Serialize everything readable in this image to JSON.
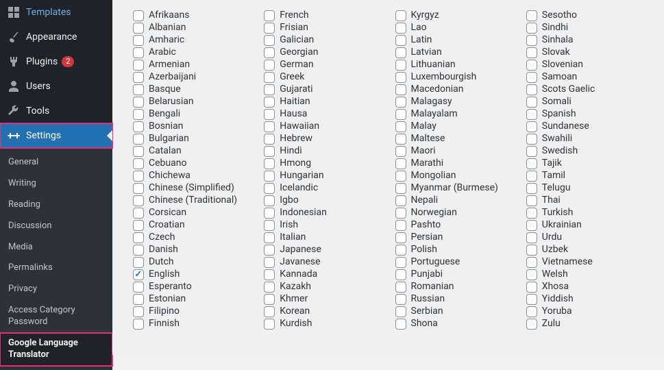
{
  "sidebar": {
    "menu": [
      {
        "id": "templates",
        "label": "Templates",
        "icon": "templates"
      },
      {
        "id": "appearance",
        "label": "Appearance",
        "icon": "brush"
      },
      {
        "id": "plugins",
        "label": "Plugins",
        "icon": "plug",
        "badge": "2"
      },
      {
        "id": "users",
        "label": "Users",
        "icon": "user"
      },
      {
        "id": "tools",
        "label": "Tools",
        "icon": "wrench"
      },
      {
        "id": "settings",
        "label": "Settings",
        "icon": "sliders",
        "active": true,
        "highlight": true
      }
    ],
    "submenu": [
      {
        "id": "general",
        "label": "General"
      },
      {
        "id": "writing",
        "label": "Writing"
      },
      {
        "id": "reading",
        "label": "Reading"
      },
      {
        "id": "discussion",
        "label": "Discussion"
      },
      {
        "id": "media",
        "label": "Media"
      },
      {
        "id": "permalinks",
        "label": "Permalinks"
      },
      {
        "id": "privacy",
        "label": "Privacy"
      },
      {
        "id": "access-category-password",
        "label": "Access Category Password"
      },
      {
        "id": "google-language-translator",
        "label": "Google Language Translator",
        "current": true,
        "highlight": true
      }
    ]
  },
  "languages": {
    "columns": [
      [
        "Afrikaans",
        "Albanian",
        "Amharic",
        "Arabic",
        "Armenian",
        "Azerbaijani",
        "Basque",
        "Belarusian",
        "Bengali",
        "Bosnian",
        "Bulgarian",
        "Catalan",
        "Cebuano",
        "Chichewa",
        "Chinese (Simplified)",
        "Chinese (Traditional)",
        "Corsican",
        "Croatian",
        "Czech",
        "Danish",
        "Dutch",
        "English",
        "Esperanto",
        "Estonian",
        "Filipino",
        "Finnish"
      ],
      [
        "French",
        "Frisian",
        "Galician",
        "Georgian",
        "German",
        "Greek",
        "Gujarati",
        "Haitian",
        "Hausa",
        "Hawaiian",
        "Hebrew",
        "Hindi",
        "Hmong",
        "Hungarian",
        "Icelandic",
        "Igbo",
        "Indonesian",
        "Irish",
        "Italian",
        "Japanese",
        "Javanese",
        "Kannada",
        "Kazakh",
        "Khmer",
        "Korean",
        "Kurdish"
      ],
      [
        "Kyrgyz",
        "Lao",
        "Latin",
        "Latvian",
        "Lithuanian",
        "Luxembourgish",
        "Macedonian",
        "Malagasy",
        "Malayalam",
        "Malay",
        "Maltese",
        "Maori",
        "Marathi",
        "Mongolian",
        "Myanmar (Burmese)",
        "Nepali",
        "Norwegian",
        "Pashto",
        "Persian",
        "Polish",
        "Portuguese",
        "Punjabi",
        "Romanian",
        "Russian",
        "Serbian",
        "Shona"
      ],
      [
        "Sesotho",
        "Sindhi",
        "Sinhala",
        "Slovak",
        "Slovenian",
        "Samoan",
        "Scots Gaelic",
        "Somali",
        "Spanish",
        "Sundanese",
        "Swahili",
        "Swedish",
        "Tajik",
        "Tamil",
        "Telugu",
        "Thai",
        "Turkish",
        "Ukrainian",
        "Urdu",
        "Uzbek",
        "Vietnamese",
        "Welsh",
        "Xhosa",
        "Yiddish",
        "Yoruba",
        "Zulu"
      ]
    ],
    "checked": [
      "English"
    ]
  }
}
